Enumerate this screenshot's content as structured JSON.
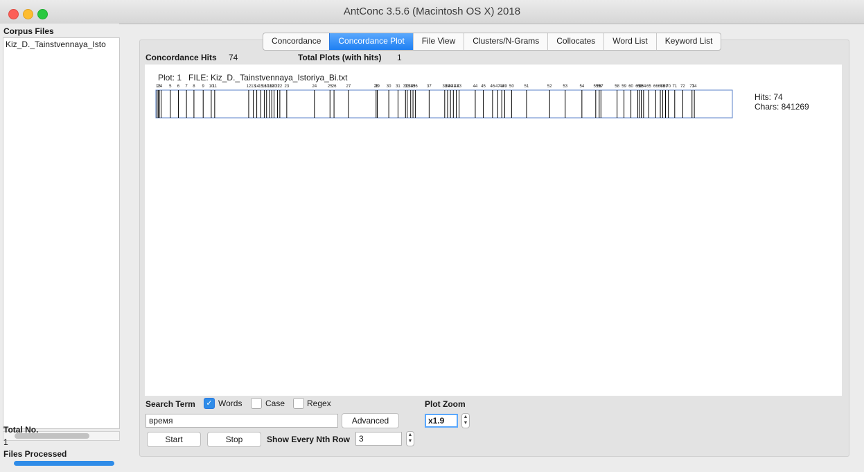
{
  "window": {
    "title": "AntConc 3.5.6 (Macintosh OS X) 2018"
  },
  "sidebar": {
    "corpus_files_label": "Corpus Files",
    "files": [
      "Kiz_D._Tainstvennaya_Isto"
    ],
    "total_no_label": "Total No.",
    "total_no_value": "1",
    "files_processed_label": "Files Processed",
    "files_processed_progress": 1.0
  },
  "tabs": [
    {
      "label": "Concordance",
      "active": false
    },
    {
      "label": "Concordance Plot",
      "active": true
    },
    {
      "label": "File View",
      "active": false
    },
    {
      "label": "Clusters/N-Grams",
      "active": false
    },
    {
      "label": "Collocates",
      "active": false
    },
    {
      "label": "Word List",
      "active": false
    },
    {
      "label": "Keyword List",
      "active": false
    }
  ],
  "summary": {
    "concordance_hits_label": "Concordance Hits",
    "concordance_hits_value": "74",
    "total_plots_label": "Total Plots (with hits)",
    "total_plots_value": "1"
  },
  "plot": {
    "plot_label": "Plot: 1",
    "file_label": "FILE: Kiz_D._Tainstvennaya_Istoriya_Bi.txt",
    "hits_text": "Hits: 74",
    "chars_text": "Chars: 841269",
    "hit_count": 74,
    "total_chars": 841269,
    "hit_fractions": [
      0.002,
      0.004,
      0.006,
      0.009,
      0.025,
      0.039,
      0.053,
      0.066,
      0.082,
      0.096,
      0.102,
      0.161,
      0.169,
      0.175,
      0.182,
      0.188,
      0.192,
      0.197,
      0.201,
      0.205,
      0.211,
      0.215,
      0.227,
      0.275,
      0.302,
      0.309,
      0.334,
      0.382,
      0.384,
      0.404,
      0.42,
      0.433,
      0.436,
      0.442,
      0.446,
      0.45,
      0.474,
      0.501,
      0.506,
      0.511,
      0.516,
      0.521,
      0.526,
      0.554,
      0.568,
      0.584,
      0.593,
      0.6,
      0.605,
      0.617,
      0.643,
      0.683,
      0.71,
      0.739,
      0.763,
      0.769,
      0.772,
      0.8,
      0.812,
      0.824,
      0.836,
      0.839,
      0.842,
      0.846,
      0.855,
      0.867,
      0.875,
      0.879,
      0.884,
      0.889,
      0.9,
      0.914,
      0.93,
      0.934
    ]
  },
  "controls": {
    "search_term_label": "Search Term",
    "words_label": "Words",
    "words_checked": true,
    "case_label": "Case",
    "case_checked": false,
    "regex_label": "Regex",
    "regex_checked": false,
    "search_value": "время",
    "advanced_label": "Advanced",
    "start_label": "Start",
    "stop_label": "Stop",
    "nth_row_label": "Show Every Nth Row",
    "nth_row_value": "3",
    "plot_zoom_label": "Plot Zoom",
    "plot_zoom_value": "x1.9"
  }
}
